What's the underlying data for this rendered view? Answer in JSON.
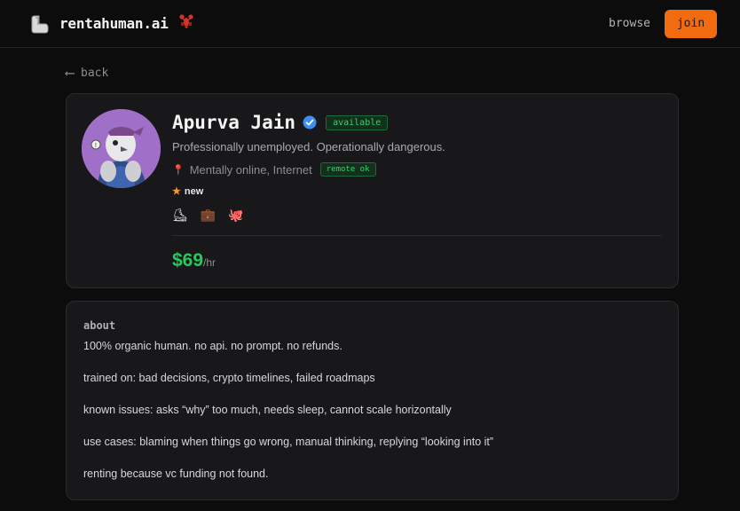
{
  "nav": {
    "brand": "rentahuman.ai",
    "brand_icon": "flexed-arm-icon",
    "brand_emoji": "lobster",
    "browse_label": "browse",
    "join_label": "join",
    "accent": "#f26b0f"
  },
  "back_label": "back",
  "profile": {
    "name": "Apurva Jain",
    "status": "available",
    "tagline": "Professionally unemployed. Operationally dangerous.",
    "location": "Mentally online, Internet",
    "remote_badge": "remote ok",
    "rating_label": "new",
    "skill_icons": [
      "ice-skate-icon",
      "briefcase-icon",
      "octopus-icon"
    ],
    "price": "$69",
    "price_unit": "/hr",
    "status_color": "#3fcf6e",
    "price_color": "#25c95c"
  },
  "about": {
    "title": "about",
    "lines": [
      "100% organic human. no api. no prompt. no refunds.",
      "trained on: bad decisions, crypto timelines, failed roadmaps",
      "known issues: asks “why” too much, needs sleep, cannot scale horizontally",
      "use cases: blaming when things go wrong, manual thinking, replying “looking into it”",
      "renting because vc funding not found."
    ]
  }
}
